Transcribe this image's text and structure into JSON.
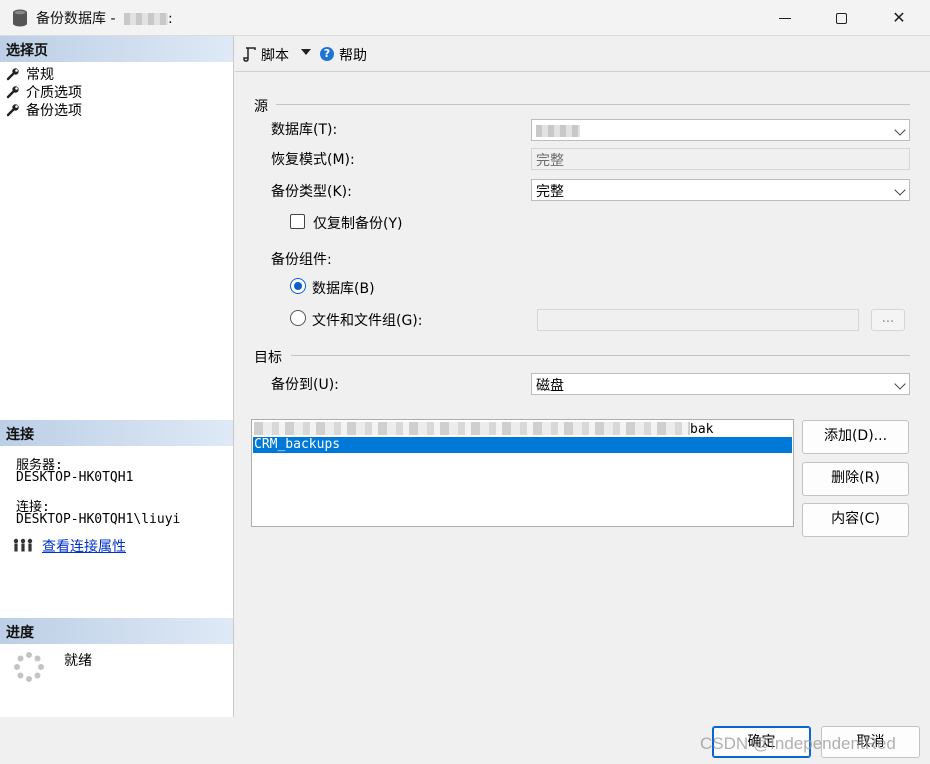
{
  "window": {
    "title": "备份数据库 - ",
    "title_suffix": ":"
  },
  "sidebar": {
    "select_page_header": "选择页",
    "items": [
      {
        "label": "常规"
      },
      {
        "label": "介质选项"
      },
      {
        "label": "备份选项"
      }
    ],
    "connection": {
      "header": "连接",
      "server_label": "服务器:",
      "server_value": "DESKTOP-HK0TQH1",
      "connection_label": "连接:",
      "connection_value": "DESKTOP-HK0TQH1\\liuyi",
      "view_properties_link": "查看连接属性"
    },
    "progress": {
      "header": "进度",
      "status": "就绪"
    }
  },
  "toolbar": {
    "script_label": "脚本",
    "help_label": "帮助"
  },
  "source": {
    "group_title": "源",
    "database_label": "数据库(T):",
    "database_value": "",
    "recovery_label": "恢复模式(M):",
    "recovery_value": "完整",
    "backup_type_label": "备份类型(K):",
    "backup_type_value": "完整",
    "copy_only_label": "仅复制备份(Y)",
    "copy_only_checked": false,
    "component_label": "备份组件:",
    "component_options": [
      {
        "label": "数据库(B)",
        "selected": true
      },
      {
        "label": "文件和文件组(G):",
        "selected": false
      }
    ],
    "browse_label": "..."
  },
  "destination": {
    "group_title": "目标",
    "backup_to_label": "备份到(U):",
    "backup_to_value": "磁盘",
    "list_items": [
      {
        "text": "bak",
        "selected": false
      },
      {
        "text": "CRM_backups",
        "selected": true
      }
    ],
    "add_button": "添加(D)...",
    "remove_button": "删除(R)",
    "contents_button": "内容(C)"
  },
  "footer": {
    "ok_button": "确定",
    "cancel_button": "取消",
    "watermark": "CSDN @IndependentRed"
  },
  "colors": {
    "accent": "#0078d7",
    "section_header_start": "#bccfe6",
    "link": "#0033cc"
  }
}
